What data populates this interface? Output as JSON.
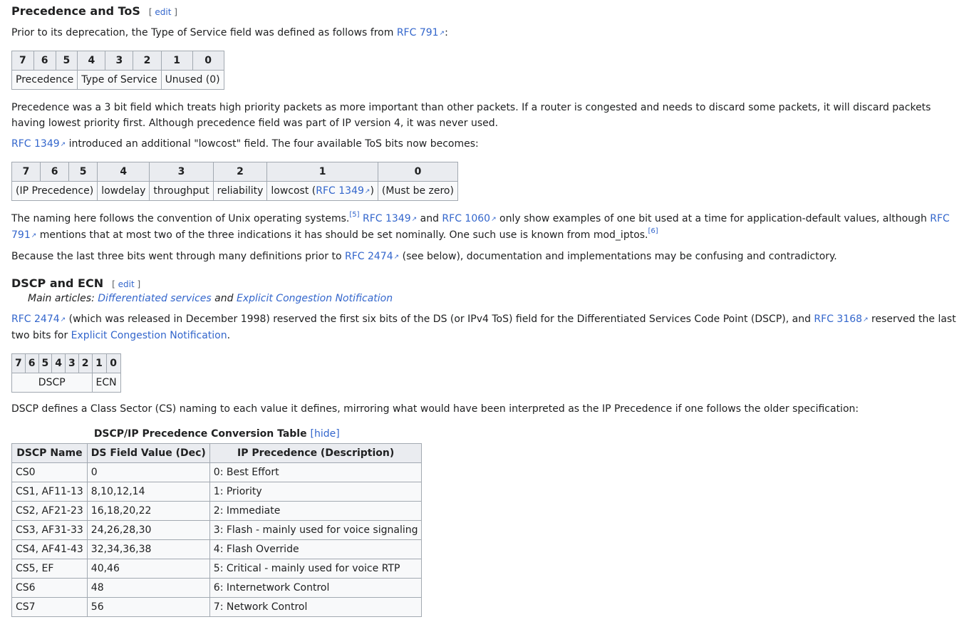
{
  "section1": {
    "title": "Precedence and ToS",
    "edit_open": "[ ",
    "edit_label": "edit",
    "edit_close": " ]",
    "intro_text": "Prior to its deprecation, the Type of Service field was defined as follows from ",
    "intro_link": "RFC 791",
    "intro_end": ":",
    "table1": {
      "bits": [
        "7",
        "6",
        "5",
        "4",
        "3",
        "2",
        "1",
        "0"
      ],
      "fields": [
        "Precedence",
        "Type of Service",
        "Unused (0)"
      ]
    },
    "para1": "Precedence was a 3 bit field which treats high priority packets as more important than other packets. If a router is congested and needs to discard some packets, it will discard packets having lowest priority first. Although precedence field was part of IP version 4, it was never used.",
    "para2_link": "RFC 1349",
    "para2_text": " introduced an additional \"lowcost\" field. The four available ToS bits now becomes:",
    "table2": {
      "bits": [
        "7",
        "6",
        "5",
        "4",
        "3",
        "2",
        "1",
        "0"
      ],
      "fields": [
        "(IP Precedence)",
        "lowdelay",
        "throughput",
        "reliability",
        "lowcost (",
        "RFC 1349",
        ")",
        "(Must be zero)"
      ]
    },
    "para3": {
      "t1": "The naming here follows the convention of Unix operating systems.",
      "sup1": "[5]",
      "l1": "RFC 1349",
      "t2": " and ",
      "l2": "RFC 1060",
      "t3": " only show examples of one bit used at a time for application-default values, although ",
      "l3": "RFC 791",
      "t4": " mentions that at most two of the three indications it has should be set nominally. One such use is known from mod_iptos.",
      "sup2": "[6]"
    },
    "para4": {
      "t1": "Because the last three bits went through many definitions prior to ",
      "l1": "RFC 2474",
      "t2": " (see below), documentation and implementations may be confusing and contradictory."
    }
  },
  "section2": {
    "title": "DSCP and ECN",
    "edit_open": "[ ",
    "edit_label": "edit",
    "edit_close": " ]",
    "hatnote": {
      "prefix": "Main articles: ",
      "l1": "Differentiated services",
      "mid": " and ",
      "l2": "Explicit Congestion Notification"
    },
    "para1": {
      "l1": "RFC 2474",
      "t1": " (which was released in December 1998) reserved the first six bits of the DS (or IPv4 ToS) field for the Differentiated Services Code Point (DSCP), and ",
      "l2": "RFC 3168",
      "t2": " reserved the last two bits for ",
      "l3": "Explicit Congestion Notification",
      "t3": "."
    },
    "table3": {
      "bits": [
        "7",
        "6",
        "5",
        "4",
        "3",
        "2",
        "1",
        "0"
      ],
      "fields": [
        "DSCP",
        "ECN"
      ]
    },
    "para2": "DSCP defines a Class Sector (CS) naming to each value it defines, mirroring what would have been interpreted as the IP Precedence if one follows the older specification:",
    "conv_table": {
      "caption": "DSCP/IP Precedence Conversion Table",
      "hide_label": "[hide]",
      "headers": [
        "DSCP Name",
        "DS Field Value (Dec)",
        "IP Precedence (Description)"
      ],
      "rows": [
        [
          "CS0",
          "0",
          "0: Best Effort"
        ],
        [
          "CS1, AF11-13",
          "8,10,12,14",
          "1: Priority"
        ],
        [
          "CS2, AF21-23",
          "16,18,20,22",
          "2: Immediate"
        ],
        [
          "CS3, AF31-33",
          "24,26,28,30",
          "3: Flash - mainly used for voice signaling"
        ],
        [
          "CS4, AF41-43",
          "32,34,36,38",
          "4: Flash Override"
        ],
        [
          "CS5, EF",
          "40,46",
          "5: Critical - mainly used for voice RTP"
        ],
        [
          "CS6",
          "48",
          "6: Internetwork Control"
        ],
        [
          "CS7",
          "56",
          "7: Network Control"
        ]
      ]
    }
  }
}
